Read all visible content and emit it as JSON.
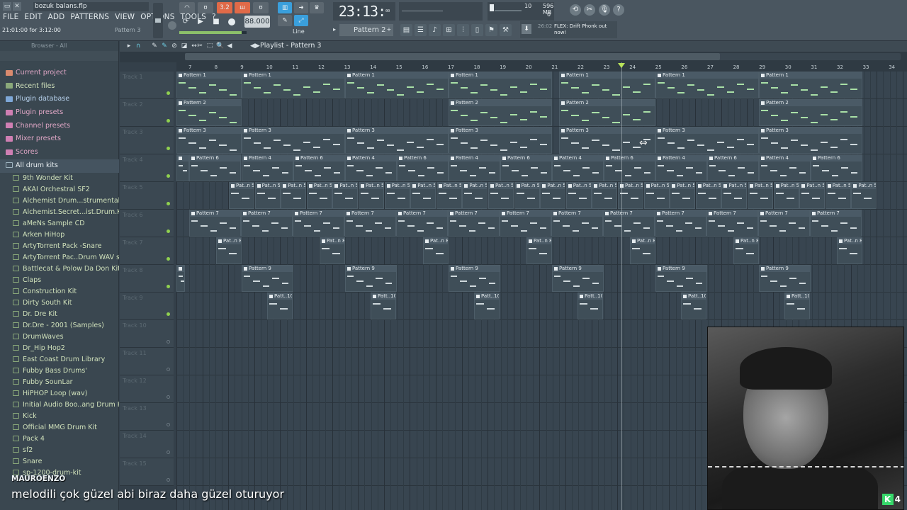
{
  "window": {
    "file_title": "bozuk balans.flp",
    "menu": [
      "FILE",
      "EDIT",
      "ADD",
      "PATTERNS",
      "VIEW",
      "OPTIONS",
      "TOOLS",
      "?"
    ],
    "time_info": "21:01:00 for 3:12:00",
    "pattern_info": "Pattern 3"
  },
  "toolbar": {
    "tempo": "88.000",
    "clock": "23:13",
    "clock_frac": "00",
    "clock_label": "B:S:T",
    "cpu_value": "10",
    "ram_value": "596 MB",
    "poly_value": "0",
    "pattern_selector": "Pattern 2",
    "snap": "Line",
    "news_time": "26:02",
    "news_text": "FLEX: Drift Phonk out now!",
    "btn_pat": "PAT",
    "btn_song": "SONG",
    "btn_rec": "REC"
  },
  "browser": {
    "header": "Browser - All",
    "roots": [
      "Current project",
      "Recent files",
      "Plugin database",
      "Plugin presets",
      "Channel presets",
      "Mixer presets",
      "Scores"
    ],
    "open_folder": "All drum kits",
    "kits": [
      "9th Wonder Kit",
      "AKAI Orchestral SF2",
      "Alchemist Drum...strumentals.com)",
      "Alchemist.Secret...ist.Drum.Kit).WAV",
      "aMeNs Sample CD",
      "Arken HiHop",
      "ArtyTorrent Pack -Snare",
      "ArtyTorrent Pac..Drum WAV samples",
      "Battlecat & Polow Da Don Kit",
      "Claps",
      "Construction Kit",
      "Dirty South Kit",
      "Dr. Dre Kit",
      "Dr.Dre - 2001 (Samples)",
      "DrumWaves",
      "Dr_Hip Hop2",
      "East Coast Drum Library",
      "Fubby  Bass Drums'",
      "Fubby SounLar",
      "HiPHOP Loop (wav)",
      "Initial Audio Boo..ang Drum Kit WiN",
      "Kick",
      "Official MMG Drum Kit",
      "Pack 4",
      "sf2",
      "Snare",
      "sp-1200-drum-kit"
    ]
  },
  "playlist": {
    "title": "Playlist - Pattern 3",
    "tracks": [
      "Track 1",
      "Track 2",
      "Track 3",
      "Track 4",
      "Track 5",
      "Track 6",
      "Track 7",
      "Track 8",
      "Track 9",
      "Track 10",
      "Track 11",
      "Track 12",
      "Track 13",
      "Track 14",
      "Track 15"
    ],
    "ruler": [
      "7",
      "8",
      "9",
      "10",
      "11",
      "12",
      "13",
      "14",
      "15",
      "16",
      "17",
      "18",
      "19",
      "20",
      "21",
      "22",
      "23",
      "24",
      "25",
      "26",
      "27",
      "28",
      "29",
      "30",
      "31",
      "32",
      "33",
      "34"
    ]
  },
  "overlay": {
    "chat_name": "MAUROENZO",
    "chat_msg": "melodili çok güzel abi biraz daha güzel oturuyor",
    "badge_letter": "K",
    "badge_num": "4"
  }
}
